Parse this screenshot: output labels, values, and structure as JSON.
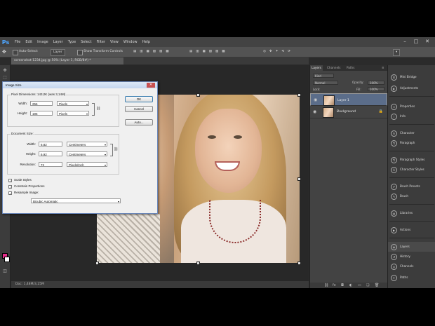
{
  "menubar": {
    "logo": "Ps",
    "items": [
      "File",
      "Edit",
      "Image",
      "Layer",
      "Type",
      "Select",
      "Filter",
      "View",
      "Window",
      "Help"
    ],
    "window_controls": [
      "–",
      "□",
      "✕"
    ]
  },
  "options_bar": {
    "auto_select": "Auto-Select:",
    "auto_select_value": "Layer",
    "show_transform": "Show Transform Controls"
  },
  "document": {
    "tab": "screenshot-1234.jpg @ 50% (Layer 1, RGB/8#) *",
    "status": "Doc: 1,48M/3,25M"
  },
  "dialog": {
    "title": "Image Size",
    "pixel_dimensions": "Pixel Dimensions: 143,0K (was 3,14M)",
    "pixel": {
      "width_label": "Width:",
      "width_value": "256",
      "width_unit": "Pixels",
      "height_label": "Height:",
      "height_value": "196",
      "height_unit": "Pixels"
    },
    "doc_size_label": "Document Size:",
    "doc": {
      "width_label": "Width:",
      "width_value": "6,82",
      "width_unit": "Centimeters",
      "height_label": "Height:",
      "height_value": "6,92",
      "height_unit": "Centimeters",
      "res_label": "Resolution:",
      "res_value": "72",
      "res_unit": "Pixels/Inch"
    },
    "scale_styles": "Scale Styles",
    "constrain": "Constrain Proportions",
    "resample": "Resample Image:",
    "resample_value": "Bicubic Automatic",
    "ok": "OK",
    "cancel": "Cancel",
    "auto": "Auto..."
  },
  "layers_panel": {
    "tabs": [
      "Layers",
      "Channels",
      "Paths"
    ],
    "kind": "Kind",
    "blend": "Normal",
    "opacity_label": "Opacity:",
    "opacity": "100%",
    "lock_label": "Lock:",
    "fill_label": "Fill:",
    "fill": "100%",
    "layers": [
      {
        "name": "Layer 1",
        "selected": true
      },
      {
        "name": "Background",
        "selected": false
      }
    ]
  },
  "right_strip": {
    "items": [
      "Mini Bridge",
      "Adjustments",
      "Properties",
      "Info",
      "Character",
      "Paragraph",
      "Paragraph Styles",
      "Character Styles",
      "Brush Presets",
      "Brush",
      "Libraries",
      "Actions",
      "Layers",
      "History",
      "Channels",
      "Paths"
    ]
  },
  "colors": {
    "accent": "#5b6d8a",
    "dialog_border": "#6a86b8"
  }
}
